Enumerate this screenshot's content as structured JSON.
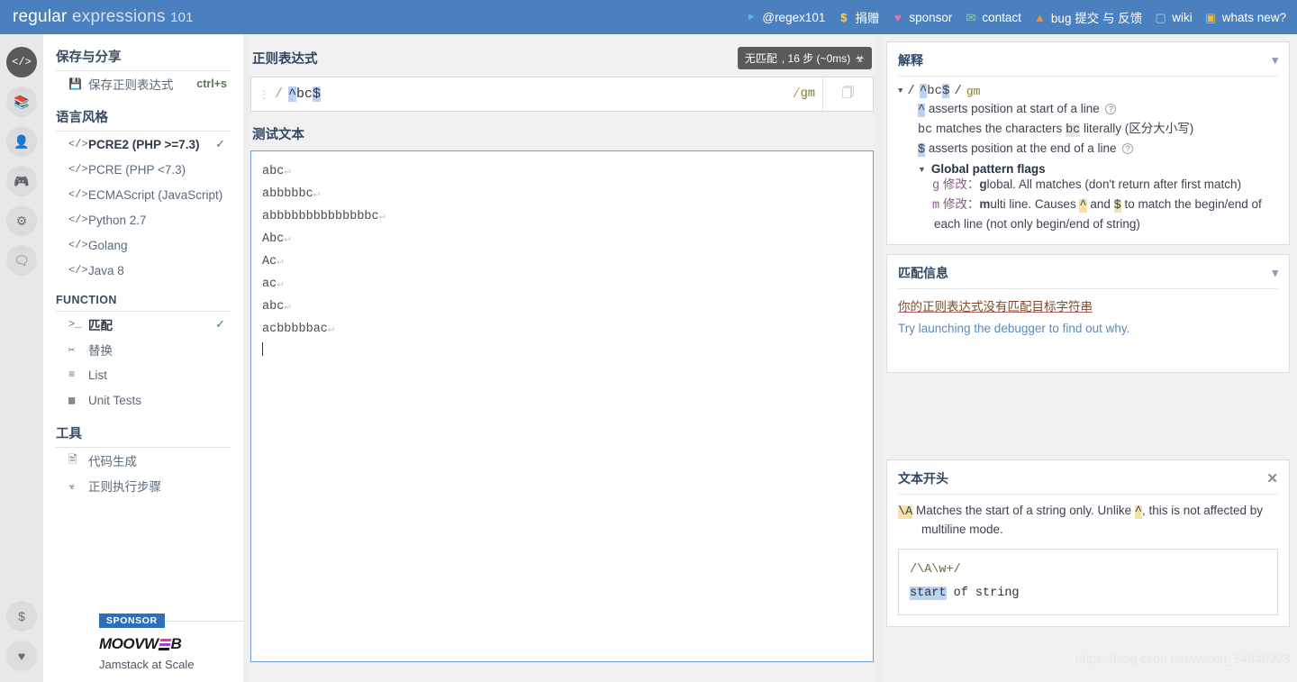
{
  "header": {
    "brand_regular": "regular ",
    "brand_expressions": "expressions ",
    "brand_101": "101",
    "nav": [
      {
        "icon": "twitter-icon",
        "glyph": "ᴠ",
        "label": "@regex101",
        "color": "#5ab8f0"
      },
      {
        "icon": "dollar-icon",
        "glyph": "$",
        "label": "捐赠",
        "color": "#ffd24d"
      },
      {
        "icon": "heart-icon",
        "glyph": "♥",
        "label": "sponsor",
        "color": "#ff6fa5"
      },
      {
        "icon": "mail-icon",
        "glyph": "✉",
        "label": "contact",
        "color": "#8fd6a8"
      },
      {
        "icon": "warning-icon",
        "glyph": "⚠",
        "label": "bug 提交 与 反馈",
        "color": "#f0952f"
      },
      {
        "icon": "wiki-icon",
        "glyph": "?",
        "label": "wiki",
        "color": "#9fd0f5"
      },
      {
        "icon": "news-icon",
        "glyph": "☰",
        "label": "whats new?",
        "color": "#f3b93d"
      }
    ]
  },
  "rail": {
    "top": [
      {
        "name": "code-icon",
        "glyph": "</>",
        "active": true
      },
      {
        "name": "library-icon",
        "glyph": "☰",
        "active": false
      },
      {
        "name": "account-icon",
        "glyph": "●",
        "active": false
      },
      {
        "name": "gamepad-icon",
        "glyph": "▮",
        "active": false
      },
      {
        "name": "gear-icon",
        "glyph": "⚙",
        "active": false
      },
      {
        "name": "chat-icon",
        "glyph": "▣",
        "active": false
      }
    ],
    "bottom": [
      {
        "name": "donate-icon",
        "glyph": "$"
      },
      {
        "name": "sponsor-heart-icon",
        "glyph": "♥"
      }
    ]
  },
  "sidebar": {
    "save_share_header": "保存与分享",
    "save_item": {
      "label": "保存正则表达式",
      "shortcut": "ctrl+s",
      "icon": "save-icon"
    },
    "flavor_header": "语言风格",
    "flavors": [
      {
        "label": "PCRE2 (PHP >=7.3)",
        "selected": true
      },
      {
        "label": "PCRE (PHP <7.3)",
        "selected": false
      },
      {
        "label": "ECMAScript (JavaScript)",
        "selected": false
      },
      {
        "label": "Python 2.7",
        "selected": false
      },
      {
        "label": "Golang",
        "selected": false
      },
      {
        "label": "Java 8",
        "selected": false
      }
    ],
    "function_header": "FUNCTION",
    "functions": [
      {
        "label": "匹配",
        "icon": ">_",
        "selected": true
      },
      {
        "label": "替换",
        "icon": "✂",
        "selected": false
      },
      {
        "label": "List",
        "icon": "≡",
        "selected": false
      },
      {
        "label": "Unit Tests",
        "icon": "▀",
        "selected": false
      }
    ],
    "tools_header": "工具",
    "tools": [
      {
        "label": "代码生成",
        "icon": "▧"
      },
      {
        "label": "正则执行步骤",
        "icon": "☸"
      }
    ],
    "sponsor": {
      "tag": "SPONSOR",
      "name_left": "MOOVW",
      "name_right": "B",
      "tagline": "Jamstack at Scale"
    }
  },
  "editor": {
    "regex_title": "正则表达式",
    "steps_badge": {
      "nomatch": "无匹配",
      "rest": ", 16 步 (~0ms)",
      "icon": "debugger-icon"
    },
    "delimiter": "/",
    "pattern_prefix": "^",
    "pattern_body": "bc",
    "pattern_suffix": "$",
    "flags": "gm",
    "copy_icon": "copy-icon",
    "test_title": "测试文本",
    "test_lines": [
      "abc",
      "abbbbbc",
      "abbbbbbbbbbbbbbc",
      "Abc",
      "Ac",
      "ac",
      "abc",
      "acbbbbbac"
    ]
  },
  "explanation": {
    "title": "解释",
    "pattern_delim": "/",
    "pattern_prefix": "^",
    "pattern_body": "bc",
    "pattern_suffix": "$",
    "flags": "gm",
    "lines": [
      {
        "token": "^",
        "text": "asserts position at start of a line",
        "help": true
      },
      {
        "token": "bc",
        "text_before": "matches the characters",
        "code": "bc",
        "text_after": "literally (区分大小写)",
        "help": false
      },
      {
        "token": "$",
        "text": "asserts position at the end of a line",
        "help": true
      }
    ],
    "flags_header": "Global pattern flags",
    "flag_items": [
      {
        "key": "g",
        "modifier": "修改：",
        "bold": "g",
        "rest": "lobal. All matches (don't return after first match)"
      },
      {
        "key": "m",
        "modifier": "修改：",
        "bold": "m",
        "rest_1": "ulti line. Causes ",
        "tok1": "^",
        "rest_2": " and ",
        "tok2": "$",
        "rest_3": " to match the begin/end of each line (not only begin/end of string)"
      }
    ]
  },
  "match_info": {
    "title": "匹配信息",
    "warning": "你的正则表达式没有匹配目标字符串",
    "link": "Try launching the debugger to find out why."
  },
  "quick_ref": {
    "title": "文本开头",
    "close_icon": "close-icon",
    "token": "\\A",
    "desc_1": "Matches the start of a string only. Unlike ",
    "token_2": "^",
    "desc_2": ", this is not affected by multiline mode.",
    "example_pattern": "/\\A\\w+/",
    "example_match": "start",
    "example_rest": " of string"
  },
  "watermark": "https://blog.csdn.net/weixin_54646993"
}
